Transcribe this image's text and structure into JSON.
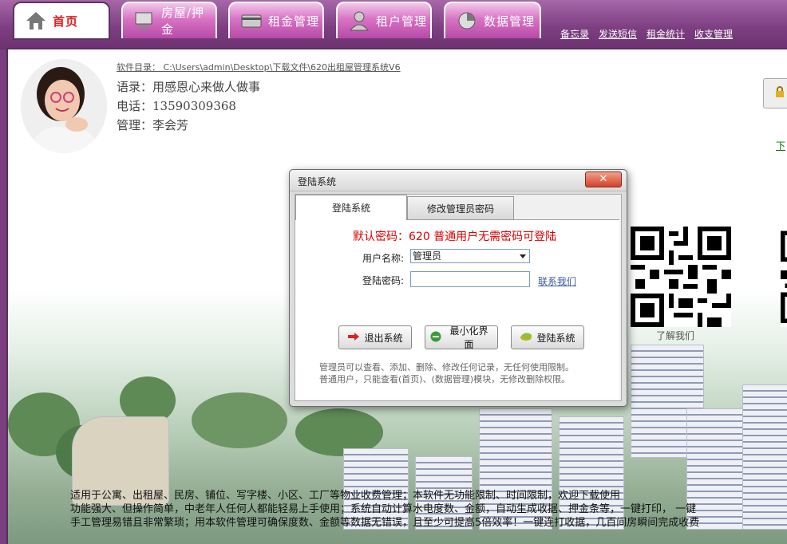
{
  "nav": {
    "tabs": [
      {
        "label": "首页"
      },
      {
        "label": "房屋/押金"
      },
      {
        "label": "租金管理"
      },
      {
        "label": "租户管理"
      },
      {
        "label": "数据管理"
      }
    ],
    "links": [
      "备忘录",
      "发送短信",
      "租金统计",
      "收支管理"
    ]
  },
  "profile": {
    "path": "软件目录： C:\\Users\\admin\\Desktop\\下载文件\\620出租屋管理系统V6",
    "motto": "语录：用感恩心来做人做事",
    "phone": "电话：13590309368",
    "manager": "管理：李会芳"
  },
  "right": {
    "download_link": "下",
    "qr_caption": "了解我们"
  },
  "bottom_text": [
    "适用于公寓、出租屋、民房、铺位、写字楼、小区、工厂等物业收费管理；本软件无功能限制、时间限制，欢迎下载使用",
    "功能强大、但操作简单，中老年人任何人都能轻易上手使用；系统自动计算水电度数、金额，自动生成收据、押金条等，一键打印，  一键",
    "手工管理易错且非常繁琐；用本软件管理可确保度数、金额等数据无错误，且至少可提高5倍效率！一键连打收据，几百间房瞬间完成收费"
  ],
  "dialog": {
    "title": "登陆系统",
    "close": "✕",
    "tabs": [
      "登陆系统",
      "修改管理员密码"
    ],
    "hint": "默认密码：620   普通用户无需密码可登陆",
    "username_label": "用户名称:",
    "username_value": "管理员",
    "password_label": "登陆密码:",
    "password_value": "",
    "contact_link": "联系我们",
    "buttons": {
      "exit": "退出系统",
      "minimize": "最小化界面",
      "login": "登陆系统"
    },
    "notes": [
      "管理员可以查看、添加、删除、修改任何记录，无任何使用限制。",
      "普通用户，只能查看(首页)、(数据管理)模块，无修改删除权限。"
    ]
  },
  "colors": {
    "nav_bg": "#7d3f82",
    "tab_pink": "#d873c4",
    "hint_red": "#dd0000",
    "link_blue": "#3a5aa0"
  }
}
